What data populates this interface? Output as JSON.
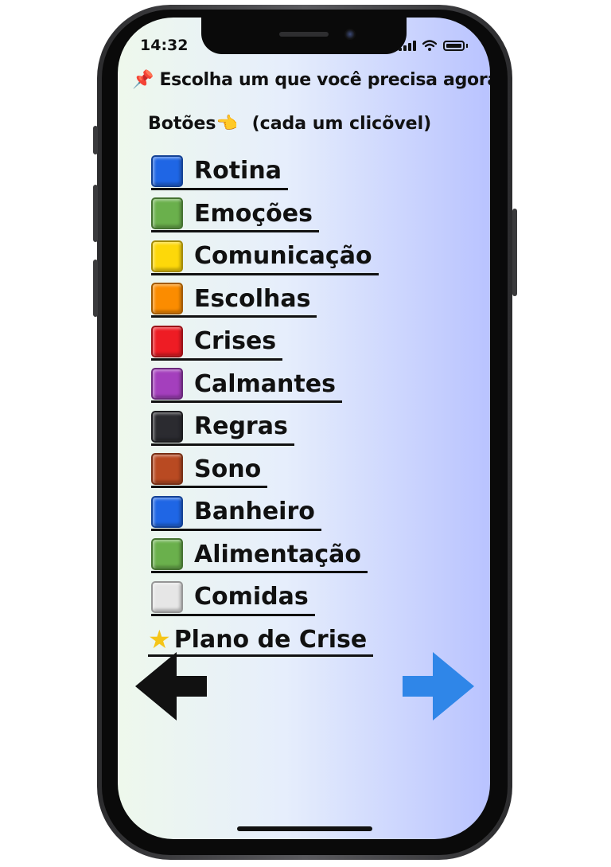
{
  "status_bar": {
    "time": "14:32"
  },
  "header": {
    "pin_icon": "📌",
    "title": "Escolha um que você precisa agora",
    "subtitle_prefix": "Botões",
    "pointing_icon": "👈",
    "subtitle_suffix": "(cada um clicõvel)"
  },
  "menu": {
    "items": [
      {
        "label": "Rotina",
        "color": "#1f66e5"
      },
      {
        "label": "Emoções",
        "color": "#6ab04c"
      },
      {
        "label": "Comunicação",
        "color": "#fdd80a"
      },
      {
        "label": "Escolhas",
        "color": "#fb8c00"
      },
      {
        "label": "Crises",
        "color": "#ee1c24"
      },
      {
        "label": "Calmantes",
        "color": "#a43fbd"
      },
      {
        "label": "Regras",
        "color": "#2b2b30"
      },
      {
        "label": "Sono",
        "color": "#b94a22"
      },
      {
        "label": "Banheiro",
        "color": "#1f66e5"
      },
      {
        "label": "Alimentação",
        "color": "#6ab04c"
      },
      {
        "label": "Comidas",
        "color": "#e6e6e6"
      }
    ],
    "special": {
      "label": "Plano de Crise",
      "icon": "star-icon"
    }
  },
  "navigation": {
    "back_arrow_color": "#111111",
    "next_arrow_color": "#2f86e8"
  }
}
